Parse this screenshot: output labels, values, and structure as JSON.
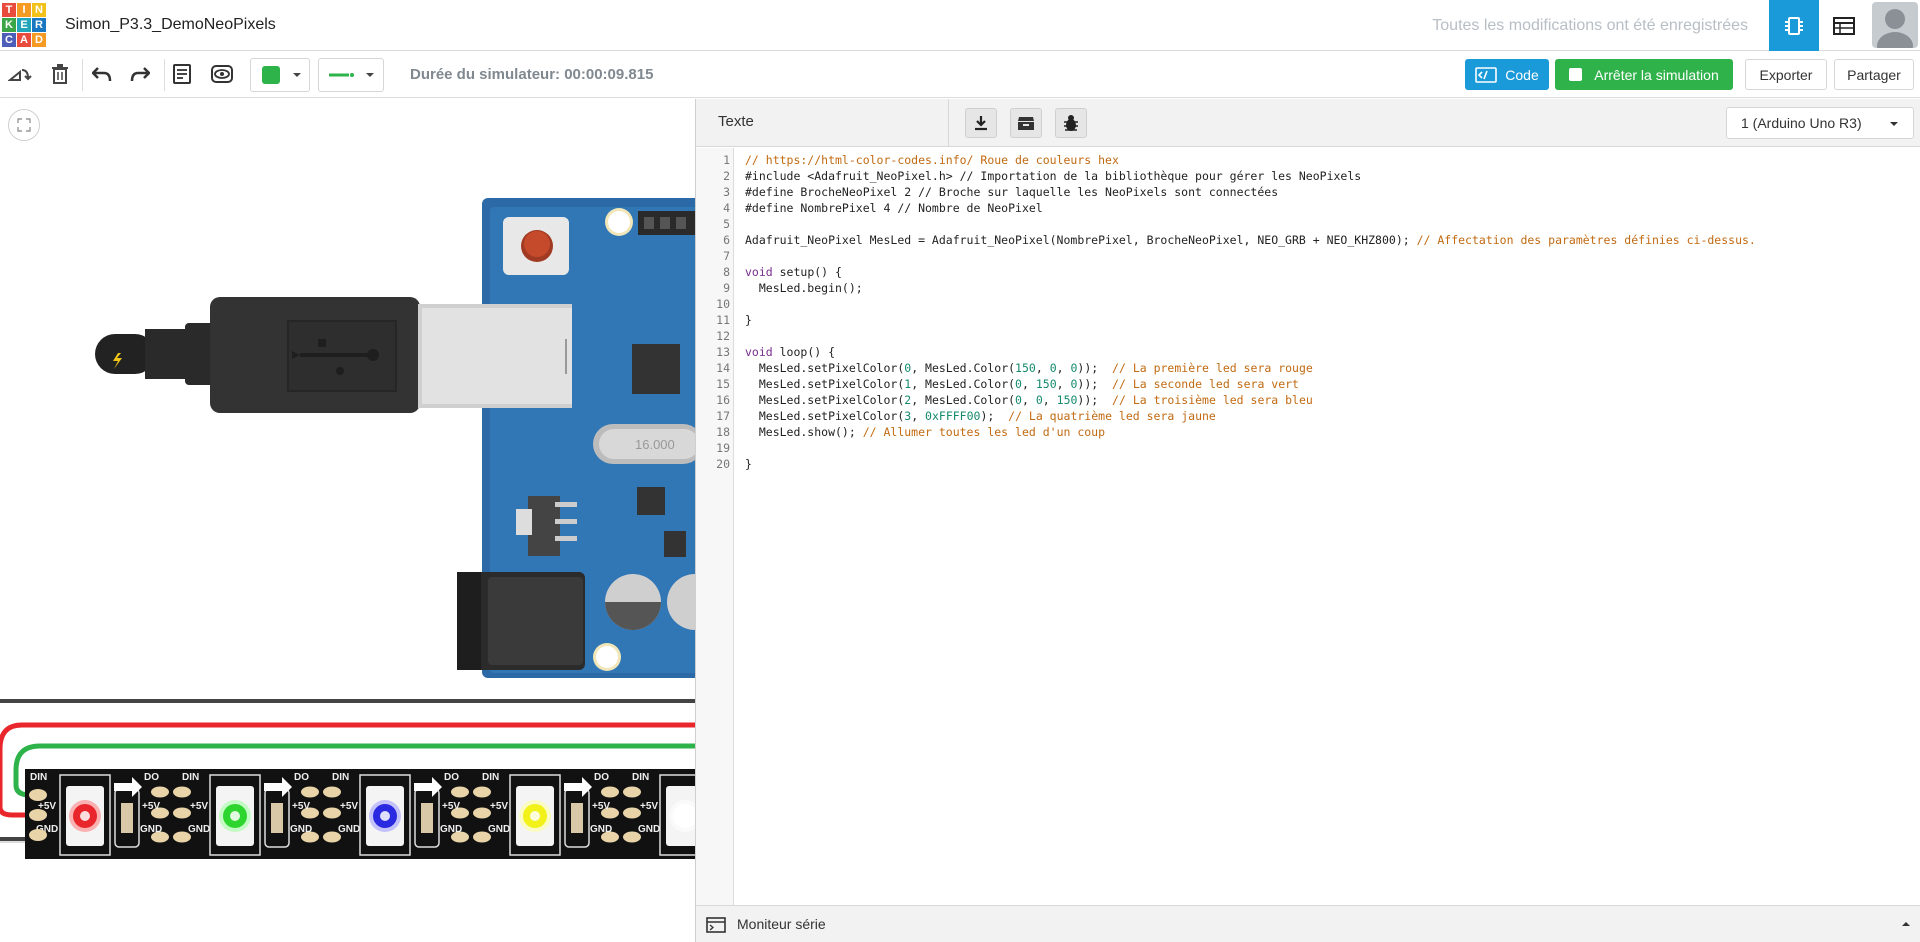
{
  "app": {
    "logo_letters": [
      "T",
      "I",
      "N",
      "K",
      "E",
      "R",
      "C",
      "A",
      "D"
    ],
    "logo_colors": [
      "#e94c3d",
      "#f59a23",
      "#f2c21a",
      "#3aa648",
      "#20a6b8",
      "#1a78c2",
      "#4d5eb8",
      "#e94c3d",
      "#f59a23"
    ],
    "project_title": "Simon_P3.3_DemoNeoPixels",
    "save_status": "Toutes les modifications ont été enregistrées"
  },
  "header_icons": {
    "circuit_view": "circuit-view-icon",
    "component_list": "component-list-icon",
    "user": "user-avatar"
  },
  "toolbar": {
    "icons": [
      "rotate-icon",
      "delete-icon",
      "undo-icon",
      "redo-icon",
      "notes-icon",
      "visibility-icon"
    ],
    "fill_color": "#2db34a",
    "wire_color": "#2db34a",
    "sim_duration": "Durée du simulateur: 00:00:09.815",
    "code_label": "Code",
    "stop_label": "Arrêter la simulation",
    "export_label": "Exporter",
    "share_label": "Partager"
  },
  "code_panel": {
    "mode_label": "Texte",
    "tools": [
      "download-icon",
      "library-icon",
      "debug-icon"
    ],
    "board": "1 (Arduino Uno R3)",
    "serial_monitor": "Moniteur série",
    "line_numbers": "1\n2\n3\n4\n5\n6\n7\n8\n9\n10\n11\n12\n13\n14\n15\n16\n17\n18\n19\n20",
    "lines": [
      [
        [
          "c",
          "// https://html-color-codes.info/ Roue de couleurs hex"
        ]
      ],
      [
        [
          "t",
          "#include <Adafruit_NeoPixel.h> // Importation de la bibliothèque pour gérer les NeoPixels"
        ]
      ],
      [
        [
          "t",
          "#define BrocheNeoPixel 2 // Broche sur laquelle les NeoPixels sont connectées"
        ]
      ],
      [
        [
          "t",
          "#define NombrePixel 4 // Nombre de NeoPixel"
        ]
      ],
      [
        [
          "t",
          ""
        ]
      ],
      [
        [
          "t",
          "Adafruit_NeoPixel MesLed = Adafruit_NeoPixel(NombrePixel, BrocheNeoPixel, NEO_GRB + NEO_KHZ800); "
        ],
        [
          "c",
          "// Affectation des paramètres définies ci-dessus."
        ]
      ],
      [
        [
          "t",
          ""
        ]
      ],
      [
        [
          "k",
          "void"
        ],
        [
          "t",
          " setup() {"
        ]
      ],
      [
        [
          "t",
          "  MesLed.begin();"
        ]
      ],
      [
        [
          "t",
          ""
        ]
      ],
      [
        [
          "t",
          "}"
        ]
      ],
      [
        [
          "t",
          ""
        ]
      ],
      [
        [
          "k",
          "void"
        ],
        [
          "t",
          " loop() {"
        ]
      ],
      [
        [
          "t",
          "  MesLed.setPixelColor("
        ],
        [
          "n",
          "0"
        ],
        [
          "t",
          ", MesLed.Color("
        ],
        [
          "n",
          "150"
        ],
        [
          "t",
          ", "
        ],
        [
          "n",
          "0"
        ],
        [
          "t",
          ", "
        ],
        [
          "n",
          "0"
        ],
        [
          "t",
          "));  "
        ],
        [
          "c",
          "// La première led sera rouge"
        ]
      ],
      [
        [
          "t",
          "  MesLed.setPixelColor("
        ],
        [
          "n",
          "1"
        ],
        [
          "t",
          ", MesLed.Color("
        ],
        [
          "n",
          "0"
        ],
        [
          "t",
          ", "
        ],
        [
          "n",
          "150"
        ],
        [
          "t",
          ", "
        ],
        [
          "n",
          "0"
        ],
        [
          "t",
          "));  "
        ],
        [
          "c",
          "// La seconde led sera vert"
        ]
      ],
      [
        [
          "t",
          "  MesLed.setPixelColor("
        ],
        [
          "n",
          "2"
        ],
        [
          "t",
          ", MesLed.Color("
        ],
        [
          "n",
          "0"
        ],
        [
          "t",
          ", "
        ],
        [
          "n",
          "0"
        ],
        [
          "t",
          ", "
        ],
        [
          "n",
          "150"
        ],
        [
          "t",
          "));  "
        ],
        [
          "c",
          "// La troisième led sera bleu"
        ]
      ],
      [
        [
          "t",
          "  MesLed.setPixelColor("
        ],
        [
          "n",
          "3"
        ],
        [
          "t",
          ", "
        ],
        [
          "n",
          "0xFFFF00"
        ],
        [
          "t",
          ");  "
        ],
        [
          "c",
          "// La quatrième led sera jaune"
        ]
      ],
      [
        [
          "t",
          "  MesLed.show(); "
        ],
        [
          "c",
          "// Allumer toutes les led d'un coup"
        ]
      ],
      [
        [
          "t",
          ""
        ]
      ],
      [
        [
          "t",
          "}"
        ]
      ]
    ]
  },
  "circuit": {
    "crystal_label": "16.000",
    "pixel_labels": {
      "din": "DIN",
      "do": "DO",
      "v5": "+5V",
      "gnd": "GND"
    },
    "leds": [
      {
        "color": "#e8262c",
        "glow": "#ff7a7a"
      },
      {
        "color": "#2ed52e",
        "glow": "#9dff9d"
      },
      {
        "color": "#2a2ae0",
        "glow": "#9a9aff"
      },
      {
        "color": "#f2f21a",
        "glow": "#ffff9a"
      },
      {
        "color": "#ffffff",
        "glow": "#ffffff"
      }
    ],
    "wire_red": "#e8262c",
    "wire_green": "#2db34a"
  }
}
